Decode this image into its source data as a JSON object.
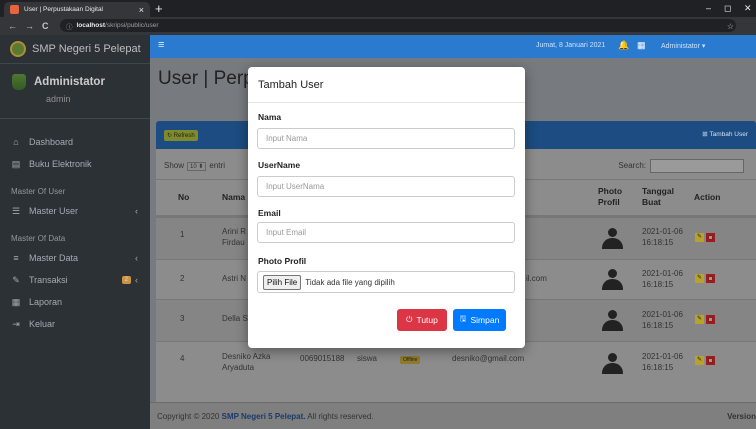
{
  "browser": {
    "tab_title": "User | Perpustakaan Digital",
    "close_glyph": "×",
    "new_tab_glyph": "+",
    "url_host": "localhost",
    "url_path": "/skripsi/public/user",
    "icons": {
      "back": "←",
      "forward": "→",
      "reload": "C",
      "info": "ⓘ",
      "star": "☆",
      "min": "–",
      "max": "◻",
      "close": "✕"
    }
  },
  "sidebar": {
    "brand": "SMP Negeri 5 Pelepat",
    "user_name": "Administator",
    "user_role": "admin",
    "items_top": [
      {
        "label": "Dashboard",
        "icon": "home-icon",
        "glyph": "⌂"
      },
      {
        "label": "Buku Elektronik",
        "icon": "book-icon",
        "glyph": "▤"
      }
    ],
    "section_user": "Master Of User",
    "master_user": {
      "label": "Master User",
      "icon": "users-icon",
      "glyph": "☰",
      "arrow": "‹"
    },
    "section_data": "Master Of Data",
    "master_data": {
      "label": "Master Data",
      "icon": "database-icon",
      "glyph": "≡",
      "arrow": "‹"
    },
    "transaksi": {
      "label": "Transaksi",
      "icon": "pencil-icon",
      "glyph": "✎",
      "badge": "2",
      "arrow": "‹"
    },
    "laporan": {
      "label": "Laporan",
      "icon": "report-icon",
      "glyph": "▦"
    },
    "keluar": {
      "label": "Keluar",
      "icon": "logout-icon",
      "glyph": "⇥"
    }
  },
  "topnav": {
    "menu_glyph": "≡",
    "date": "Jumat, 8 Januari 2021",
    "bell_glyph": "🔔",
    "grid_glyph": "▦",
    "admin": "Administator ▾"
  },
  "page": {
    "title": "User | Perpustakaan",
    "refresh": "Refresh",
    "tambah_user": "Tambah User",
    "show": "Show",
    "entries_value": "10",
    "entries": "entri",
    "search": "Search:",
    "columns": [
      "No",
      "Nama",
      "Photo Profil",
      "Tanggal Buat",
      "Action"
    ],
    "rows": [
      {
        "no": "1",
        "nama": "Arini R Firdau",
        "nisn": "",
        "level": "",
        "status": "",
        "email": "",
        "tanggal": "2021-01-06 16:18:15"
      },
      {
        "no": "2",
        "nama": "Astri N",
        "nisn": "",
        "level": "",
        "status": "",
        "email": "il.com",
        "tanggal": "2021-01-06 16:18:15"
      },
      {
        "no": "3",
        "nama": "Della S",
        "nisn": "",
        "level": "",
        "status": "",
        "email": "",
        "tanggal": "2021-01-06 16:18:15"
      },
      {
        "no": "4",
        "nama": "Desniko Azka Aryaduta",
        "nisn": "0069015188",
        "level": "siswa",
        "status": "Offline",
        "email": "desniko@gmail.com",
        "tanggal": "2021-01-06 16:18:15"
      }
    ],
    "footer_prefix": "Copyright © 2020 ",
    "footer_school": "SMP Negeri 5 Pelepat.",
    "footer_suffix": " All rights reserved.",
    "version": "Version"
  },
  "modal": {
    "title": "Tambah User",
    "nama_label": "Nama",
    "nama_placeholder": "Input Nama",
    "username_label": "UserName",
    "username_placeholder": "Input UserNama",
    "email_label": "Email",
    "email_placeholder": "Input Email",
    "photo_label": "Photo Profil",
    "file_button": "Pilih File",
    "file_status": "Tidak ada file yang dipilih",
    "tutup": "Tutup",
    "simpan": "Simpan",
    "tutup_icon": "⏻",
    "simpan_icon": "🖫"
  }
}
